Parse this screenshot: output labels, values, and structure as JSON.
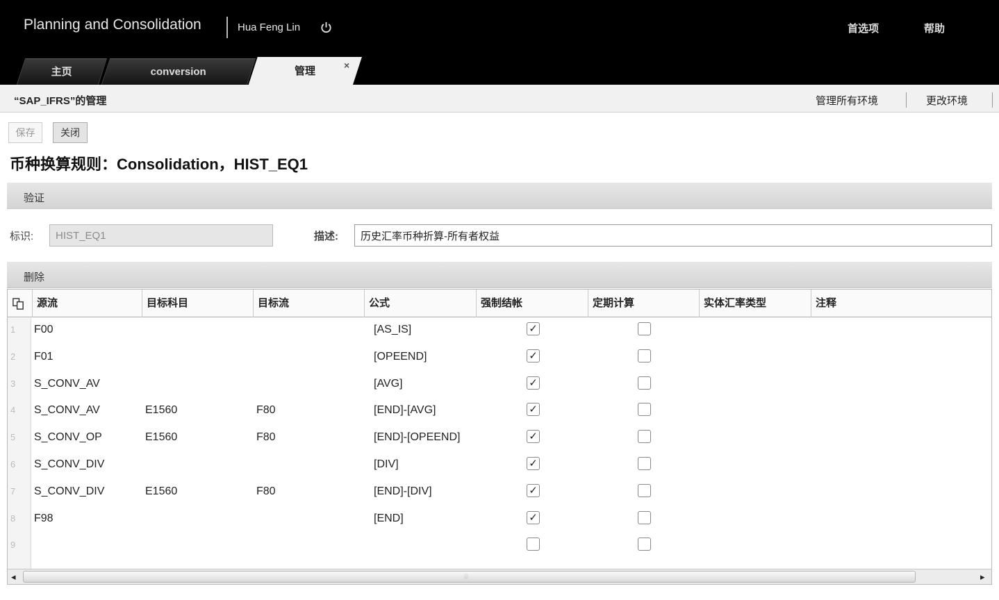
{
  "header": {
    "app_title": "Planning and Consolidation",
    "user": "Hua Feng Lin",
    "preferences": "首选项",
    "help": "帮助"
  },
  "tabs": [
    {
      "label": "主页",
      "active": false
    },
    {
      "label": "conversion",
      "active": false
    },
    {
      "label": "管理",
      "active": true,
      "close": "×"
    }
  ],
  "strip": {
    "breadcrumb": "“SAP_IFRS”的管理",
    "manage_all_envs": "管理所有环境",
    "change_env": "更改环境"
  },
  "toolbar": {
    "save": "保存",
    "close": "关闭"
  },
  "page_title": "币种换算规则：Consolidation，HIST_EQ1",
  "validation": {
    "section_label": "验证",
    "id_label": "标识:",
    "id_value": "HIST_EQ1",
    "desc_label": "描述:",
    "desc_value": "历史汇率币种折算-所有者权益"
  },
  "rules": {
    "section_label": "删除",
    "columns": [
      "源流",
      "目标科目",
      "目标流",
      "公式",
      "强制结帐",
      "定期计算",
      "实体汇率类型",
      "注释"
    ],
    "rows": [
      {
        "num": "1",
        "source": "F00",
        "target_account": "",
        "target_flow": "",
        "formula": "[AS_IS]",
        "force_close": true,
        "periodic": false,
        "rate_type": "",
        "note": ""
      },
      {
        "num": "2",
        "source": "F01",
        "target_account": "",
        "target_flow": "",
        "formula": "[OPEEND]",
        "force_close": true,
        "periodic": false,
        "rate_type": "",
        "note": ""
      },
      {
        "num": "3",
        "source": "S_CONV_AV",
        "target_account": "",
        "target_flow": "",
        "formula": "[AVG]",
        "force_close": true,
        "periodic": false,
        "rate_type": "",
        "note": ""
      },
      {
        "num": "4",
        "source": "S_CONV_AV",
        "target_account": "E1560",
        "target_flow": "F80",
        "formula": "[END]-[AVG]",
        "force_close": true,
        "periodic": false,
        "rate_type": "",
        "note": ""
      },
      {
        "num": "5",
        "source": "S_CONV_OP",
        "target_account": "E1560",
        "target_flow": "F80",
        "formula": "[END]-[OPEEND]",
        "force_close": true,
        "periodic": false,
        "rate_type": "",
        "note": ""
      },
      {
        "num": "6",
        "source": "S_CONV_DIV",
        "target_account": "",
        "target_flow": "",
        "formula": "[DIV]",
        "force_close": true,
        "periodic": false,
        "rate_type": "",
        "note": ""
      },
      {
        "num": "7",
        "source": "S_CONV_DIV",
        "target_account": "E1560",
        "target_flow": "F80",
        "formula": "[END]-[DIV]",
        "force_close": true,
        "periodic": false,
        "rate_type": "",
        "note": ""
      },
      {
        "num": "8",
        "source": "F98",
        "target_account": "",
        "target_flow": "",
        "formula": "[END]",
        "force_close": true,
        "periodic": false,
        "rate_type": "",
        "note": ""
      },
      {
        "num": "9",
        "source": "",
        "target_account": "",
        "target_flow": "",
        "formula": "",
        "force_close": false,
        "periodic": false,
        "rate_type": "",
        "note": ""
      }
    ]
  },
  "scrollbar": {
    "left_arrow": "◂",
    "right_arrow": "▸",
    "grip": "⦙⦙⦙"
  },
  "icons": {
    "power": "power-icon",
    "copy": "copy-rows-icon",
    "checkmark": "✓"
  }
}
